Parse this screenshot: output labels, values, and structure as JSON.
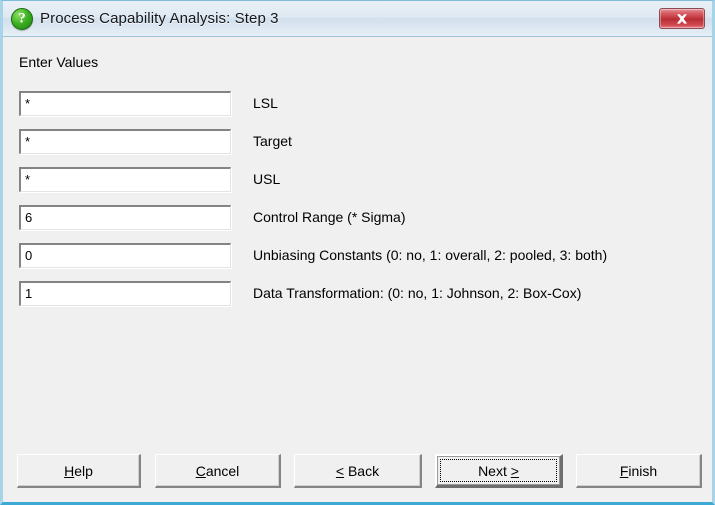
{
  "window": {
    "title": "Process Capability Analysis: Step 3",
    "icon": "question-mark-icon",
    "close_label": "x",
    "accent_color": "#3fa9d6",
    "titlebar_color": "#dfe9f2",
    "close_button_color": "#c1333c",
    "client_background": "#f0f0f0"
  },
  "main": {
    "section_label": "Enter Values",
    "fields": [
      {
        "name": "lsl",
        "value": "*",
        "label": "LSL"
      },
      {
        "name": "target",
        "value": "*",
        "label": "Target"
      },
      {
        "name": "usl",
        "value": "*",
        "label": "USL"
      },
      {
        "name": "control-range",
        "value": "6",
        "label": "Control Range (* Sigma)"
      },
      {
        "name": "unbiasing-constants",
        "value": "0",
        "label": "Unbiasing Constants (0: no, 1: overall, 2: pooled, 3: both)"
      },
      {
        "name": "data-transformation",
        "value": "1",
        "label": "Data Transformation: (0: no, 1: Johnson, 2: Box-Cox)"
      }
    ]
  },
  "buttons": {
    "help": {
      "label": "Help",
      "accel": "H"
    },
    "cancel": {
      "label": "Cancel",
      "accel": "C"
    },
    "back": {
      "label": "< Back",
      "accel": "<"
    },
    "next": {
      "label": "Next >",
      "accel": ">",
      "focused": true
    },
    "finish": {
      "label": "Finish",
      "accel": "F"
    }
  }
}
